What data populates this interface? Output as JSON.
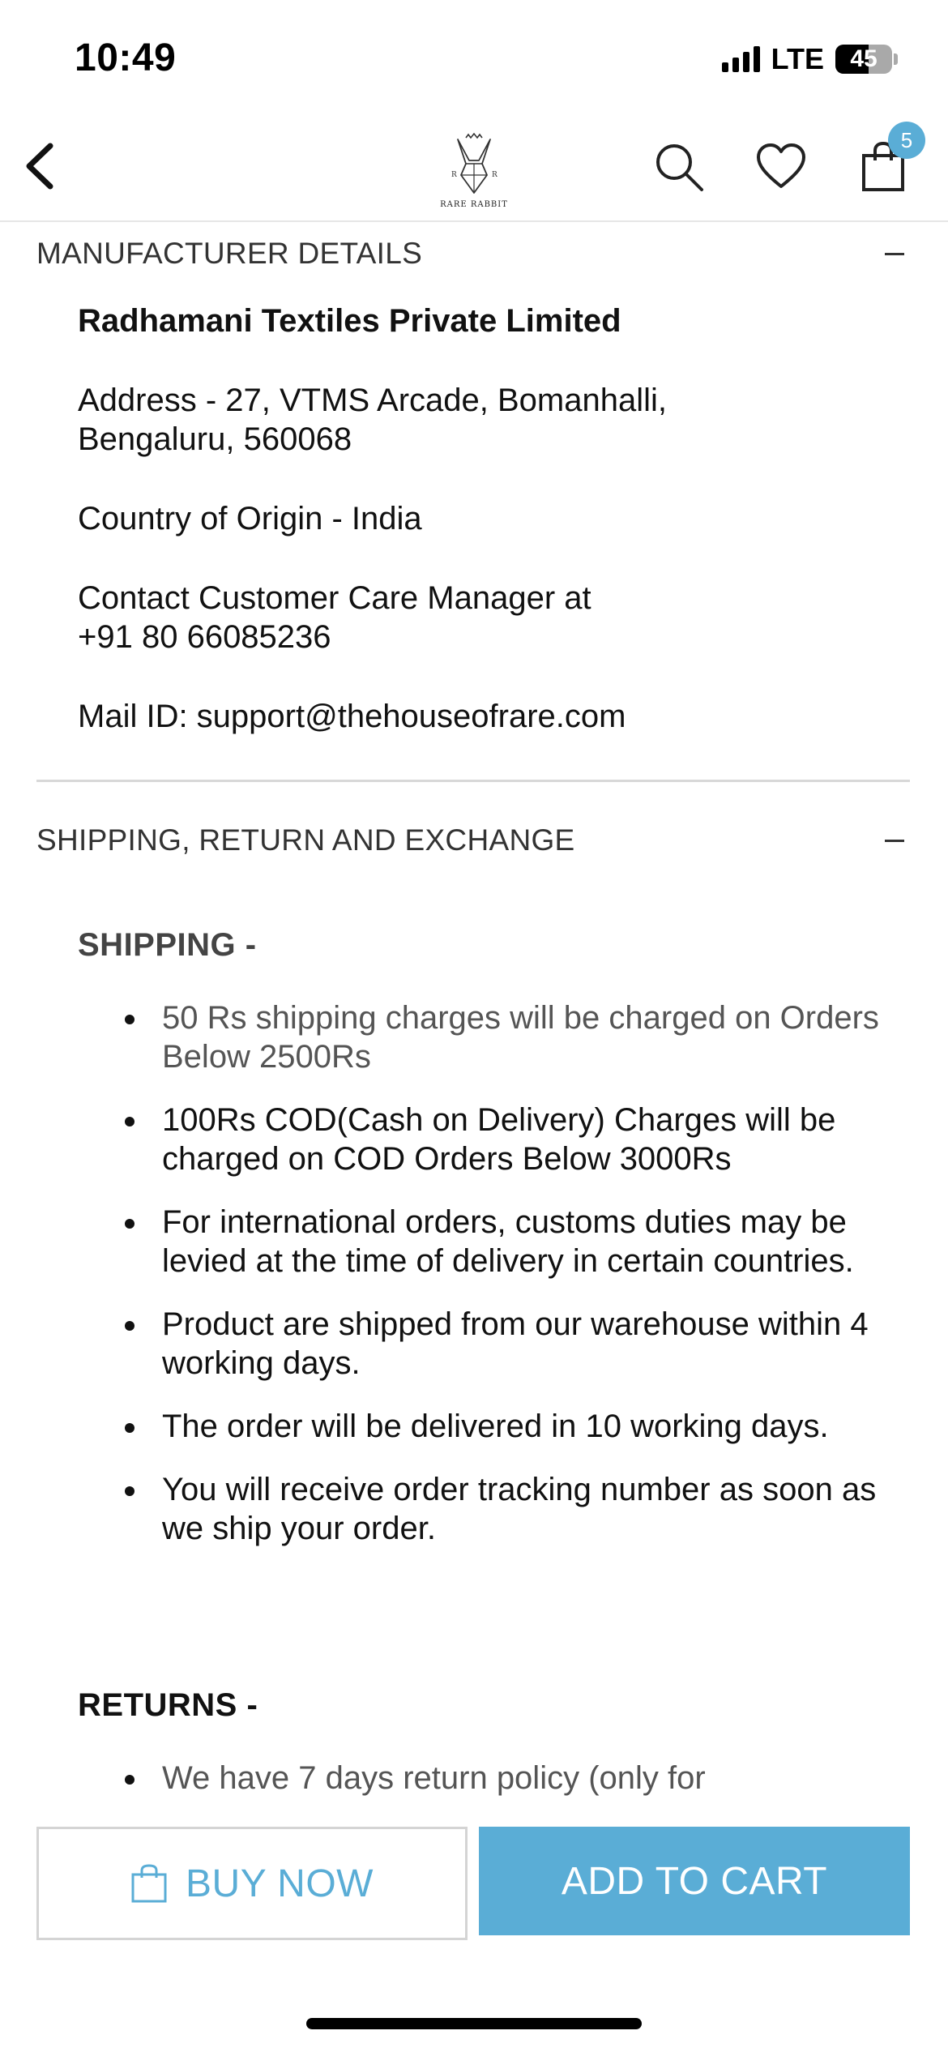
{
  "status_bar": {
    "time": "10:49",
    "network": "LTE",
    "battery": "45"
  },
  "header": {
    "logo_text": "RARE RABBIT",
    "cart_count": "5"
  },
  "manufacturer": {
    "title": "MANUFACTURER DETAILS",
    "name": "Radhamani Textiles Private Limited",
    "address_line1": "Address - 27, VTMS Arcade, Bomanhalli,",
    "address_line2": "Bengaluru, 560068",
    "origin": "Country of Origin - India",
    "contact_line1": "Contact Customer Care Manager at",
    "contact_line2": "+91 80 66085236",
    "mail": "Mail ID: support@thehouseofrare.com"
  },
  "shipping_section": {
    "title": "SHIPPING, RETURN AND EXCHANGE",
    "shipping_heading": "SHIPPING -",
    "shipping_items": [
      " 50 Rs shipping charges will be charged on Orders Below 2500Rs",
      "100Rs COD(Cash on Delivery) Charges will be charged on COD Orders Below 3000Rs",
      "For international orders, customs duties may be levied at the time of delivery in certain countries.",
      "Product are shipped from our warehouse within 4 working days.",
      "The order will be delivered in 10 working days.",
      "You will receive order tracking number as soon as we ship your order."
    ],
    "returns_heading": "RETURNS -",
    "returns_items": [
      "We have 7 days return policy (only for"
    ]
  },
  "actions": {
    "buy_now": "BUY NOW",
    "add_to_cart": "ADD TO CART"
  },
  "colors": {
    "accent": "#5aadd6"
  }
}
